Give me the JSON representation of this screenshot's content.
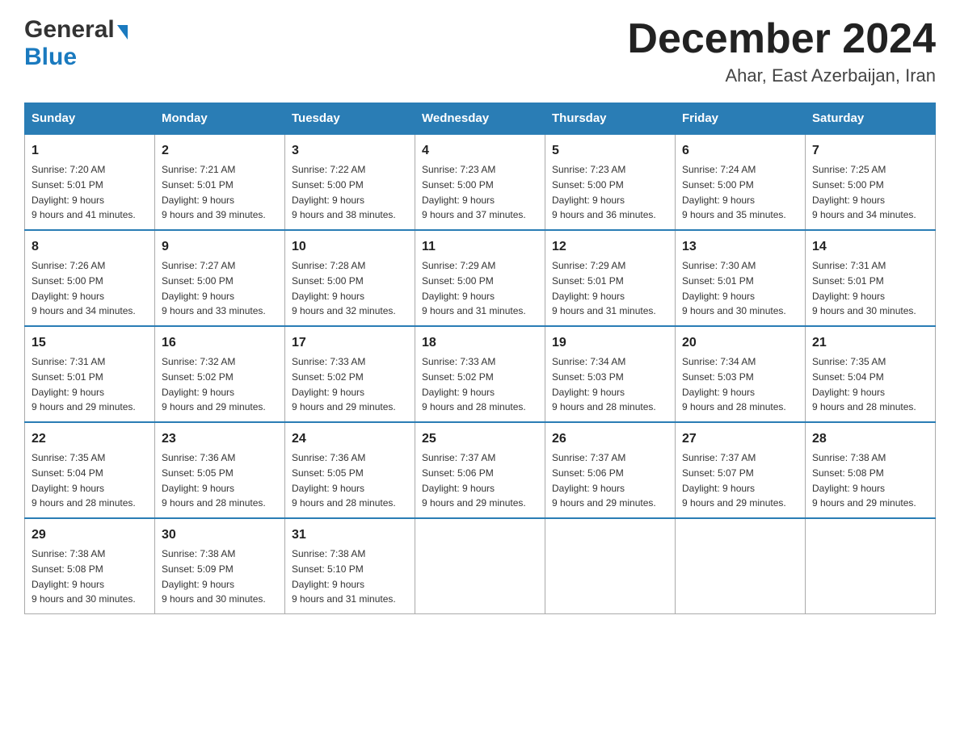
{
  "logo": {
    "line1": "General",
    "arrow": "▶",
    "line2": "Blue"
  },
  "title": "December 2024",
  "subtitle": "Ahar, East Azerbaijan, Iran",
  "days_of_week": [
    "Sunday",
    "Monday",
    "Tuesday",
    "Wednesday",
    "Thursday",
    "Friday",
    "Saturday"
  ],
  "weeks": [
    [
      {
        "day": "1",
        "sunrise": "7:20 AM",
        "sunset": "5:01 PM",
        "daylight": "9 hours and 41 minutes."
      },
      {
        "day": "2",
        "sunrise": "7:21 AM",
        "sunset": "5:01 PM",
        "daylight": "9 hours and 39 minutes."
      },
      {
        "day": "3",
        "sunrise": "7:22 AM",
        "sunset": "5:00 PM",
        "daylight": "9 hours and 38 minutes."
      },
      {
        "day": "4",
        "sunrise": "7:23 AM",
        "sunset": "5:00 PM",
        "daylight": "9 hours and 37 minutes."
      },
      {
        "day": "5",
        "sunrise": "7:23 AM",
        "sunset": "5:00 PM",
        "daylight": "9 hours and 36 minutes."
      },
      {
        "day": "6",
        "sunrise": "7:24 AM",
        "sunset": "5:00 PM",
        "daylight": "9 hours and 35 minutes."
      },
      {
        "day": "7",
        "sunrise": "7:25 AM",
        "sunset": "5:00 PM",
        "daylight": "9 hours and 34 minutes."
      }
    ],
    [
      {
        "day": "8",
        "sunrise": "7:26 AM",
        "sunset": "5:00 PM",
        "daylight": "9 hours and 34 minutes."
      },
      {
        "day": "9",
        "sunrise": "7:27 AM",
        "sunset": "5:00 PM",
        "daylight": "9 hours and 33 minutes."
      },
      {
        "day": "10",
        "sunrise": "7:28 AM",
        "sunset": "5:00 PM",
        "daylight": "9 hours and 32 minutes."
      },
      {
        "day": "11",
        "sunrise": "7:29 AM",
        "sunset": "5:00 PM",
        "daylight": "9 hours and 31 minutes."
      },
      {
        "day": "12",
        "sunrise": "7:29 AM",
        "sunset": "5:01 PM",
        "daylight": "9 hours and 31 minutes."
      },
      {
        "day": "13",
        "sunrise": "7:30 AM",
        "sunset": "5:01 PM",
        "daylight": "9 hours and 30 minutes."
      },
      {
        "day": "14",
        "sunrise": "7:31 AM",
        "sunset": "5:01 PM",
        "daylight": "9 hours and 30 minutes."
      }
    ],
    [
      {
        "day": "15",
        "sunrise": "7:31 AM",
        "sunset": "5:01 PM",
        "daylight": "9 hours and 29 minutes."
      },
      {
        "day": "16",
        "sunrise": "7:32 AM",
        "sunset": "5:02 PM",
        "daylight": "9 hours and 29 minutes."
      },
      {
        "day": "17",
        "sunrise": "7:33 AM",
        "sunset": "5:02 PM",
        "daylight": "9 hours and 29 minutes."
      },
      {
        "day": "18",
        "sunrise": "7:33 AM",
        "sunset": "5:02 PM",
        "daylight": "9 hours and 28 minutes."
      },
      {
        "day": "19",
        "sunrise": "7:34 AM",
        "sunset": "5:03 PM",
        "daylight": "9 hours and 28 minutes."
      },
      {
        "day": "20",
        "sunrise": "7:34 AM",
        "sunset": "5:03 PM",
        "daylight": "9 hours and 28 minutes."
      },
      {
        "day": "21",
        "sunrise": "7:35 AM",
        "sunset": "5:04 PM",
        "daylight": "9 hours and 28 minutes."
      }
    ],
    [
      {
        "day": "22",
        "sunrise": "7:35 AM",
        "sunset": "5:04 PM",
        "daylight": "9 hours and 28 minutes."
      },
      {
        "day": "23",
        "sunrise": "7:36 AM",
        "sunset": "5:05 PM",
        "daylight": "9 hours and 28 minutes."
      },
      {
        "day": "24",
        "sunrise": "7:36 AM",
        "sunset": "5:05 PM",
        "daylight": "9 hours and 28 minutes."
      },
      {
        "day": "25",
        "sunrise": "7:37 AM",
        "sunset": "5:06 PM",
        "daylight": "9 hours and 29 minutes."
      },
      {
        "day": "26",
        "sunrise": "7:37 AM",
        "sunset": "5:06 PM",
        "daylight": "9 hours and 29 minutes."
      },
      {
        "day": "27",
        "sunrise": "7:37 AM",
        "sunset": "5:07 PM",
        "daylight": "9 hours and 29 minutes."
      },
      {
        "day": "28",
        "sunrise": "7:38 AM",
        "sunset": "5:08 PM",
        "daylight": "9 hours and 29 minutes."
      }
    ],
    [
      {
        "day": "29",
        "sunrise": "7:38 AM",
        "sunset": "5:08 PM",
        "daylight": "9 hours and 30 minutes."
      },
      {
        "day": "30",
        "sunrise": "7:38 AM",
        "sunset": "5:09 PM",
        "daylight": "9 hours and 30 minutes."
      },
      {
        "day": "31",
        "sunrise": "7:38 AM",
        "sunset": "5:10 PM",
        "daylight": "9 hours and 31 minutes."
      },
      null,
      null,
      null,
      null
    ]
  ]
}
